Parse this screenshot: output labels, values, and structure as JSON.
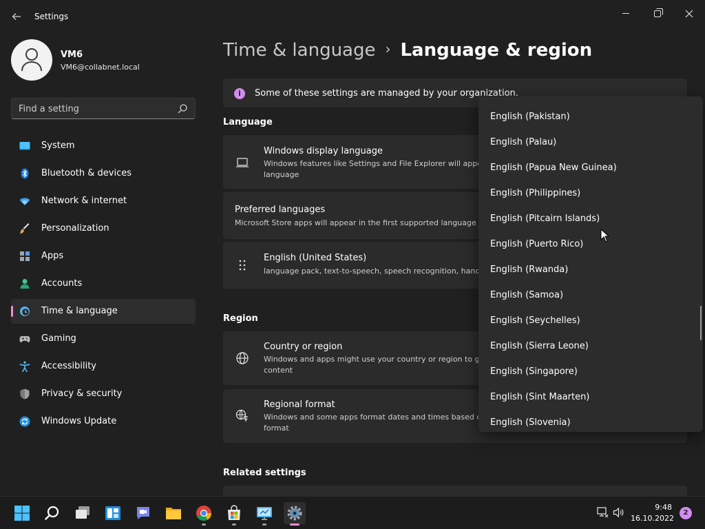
{
  "window": {
    "title": "Settings",
    "back_icon": "back-arrow-icon",
    "controls": [
      "minimize-icon",
      "restore-icon",
      "close-icon"
    ]
  },
  "profile": {
    "name": "VM6",
    "email": "VM6@collabnet.local"
  },
  "search": {
    "placeholder": "Find a setting"
  },
  "nav": {
    "items": [
      {
        "label": "System",
        "icon": "system-icon",
        "active": false
      },
      {
        "label": "Bluetooth & devices",
        "icon": "bluetooth-icon",
        "active": false
      },
      {
        "label": "Network & internet",
        "icon": "network-icon",
        "active": false
      },
      {
        "label": "Personalization",
        "icon": "brush-icon",
        "active": false
      },
      {
        "label": "Apps",
        "icon": "apps-icon",
        "active": false
      },
      {
        "label": "Accounts",
        "icon": "accounts-icon",
        "active": false
      },
      {
        "label": "Time & language",
        "icon": "time-language-icon",
        "active": true
      },
      {
        "label": "Gaming",
        "icon": "gaming-icon",
        "active": false
      },
      {
        "label": "Accessibility",
        "icon": "accessibility-icon",
        "active": false
      },
      {
        "label": "Privacy & security",
        "icon": "shield-icon",
        "active": false
      },
      {
        "label": "Windows Update",
        "icon": "update-icon",
        "active": false
      }
    ]
  },
  "breadcrumb": {
    "parent": "Time & language",
    "separator": "›",
    "current": "Language & region"
  },
  "info_bar": {
    "text": "Some of these settings are managed by your organization."
  },
  "language_section": {
    "title": "Language",
    "display_language": {
      "title": "Windows display language",
      "desc_line1": "Windows features like Settings and File Explorer will appear in this",
      "desc_line2": "language"
    },
    "preferred": {
      "title": "Preferred languages",
      "desc": "Microsoft Store apps will appear in the first supported language in this list"
    },
    "english_us": {
      "title": "English (United States)",
      "desc": "language pack, text-to-speech, speech recognition, handwriting"
    }
  },
  "region_section": {
    "title": "Region",
    "country": {
      "title": "Country or region",
      "desc_line1": "Windows and apps might use your country or region to give you local",
      "desc_line2": "content"
    },
    "format": {
      "title": "Regional format",
      "desc_line1": "Windows and some apps format dates and times based on your regional",
      "desc_line2": "format"
    }
  },
  "related_settings": {
    "title": "Related settings"
  },
  "dropdown": {
    "options": [
      "English (Pakistan)",
      "English (Palau)",
      "English (Papua New Guinea)",
      "English (Philippines)",
      "English (Pitcairn Islands)",
      "English (Puerto Rico)",
      "English (Rwanda)",
      "English (Samoa)",
      "English (Seychelles)",
      "English (Sierra Leone)",
      "English (Singapore)",
      "English (Sint Maarten)",
      "English (Slovenia)"
    ]
  },
  "taskbar": {
    "apps": [
      "start-icon",
      "search-icon",
      "task-view-icon",
      "widgets-icon",
      "teams-chat-icon",
      "file-explorer-icon",
      "chrome-icon",
      "store-icon",
      "remote-desktop-icon",
      "settings-icon"
    ],
    "time": "9:48",
    "date": "16.10.2022",
    "notifications": "2"
  },
  "colors": {
    "accent": "#f28cd6",
    "info": "#d38cf0",
    "background": "#202020",
    "card": "#2b2b2b"
  }
}
